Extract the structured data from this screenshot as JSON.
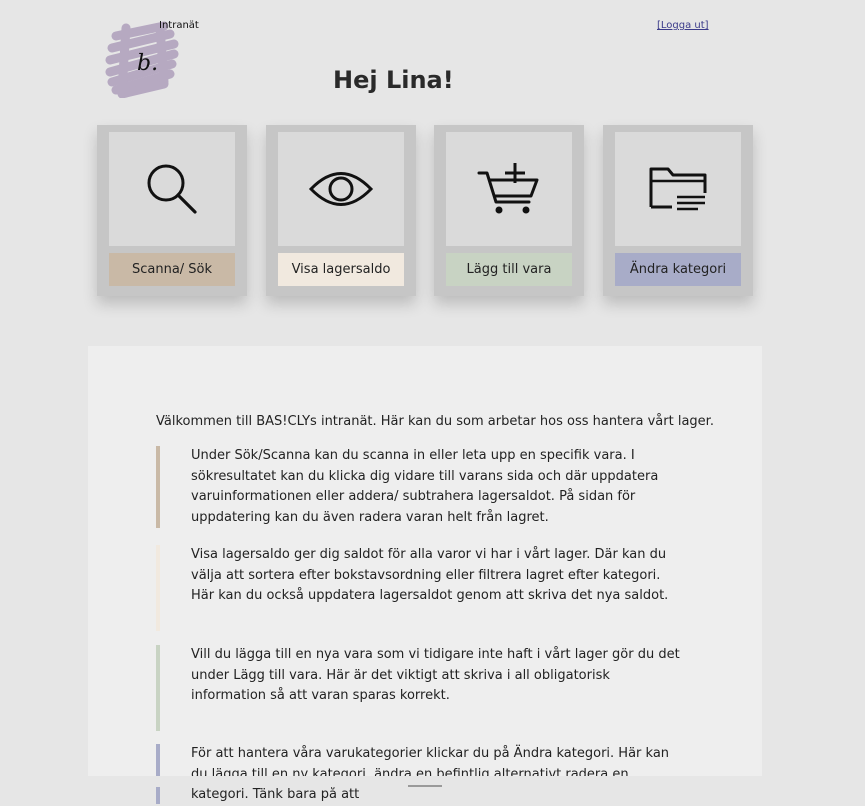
{
  "header": {
    "logo_letter": "b.",
    "logo_label": "Intranät",
    "logout_label": "[Logga ut]",
    "greeting": "Hej Lina!"
  },
  "tiles": [
    {
      "label": "Scanna/ Sök",
      "icon": "search-icon",
      "color": "#c9b9a6"
    },
    {
      "label": "Visa lagersaldo",
      "icon": "eye-icon",
      "color": "#f1e9df"
    },
    {
      "label": "Lägg till vara",
      "icon": "cart-add-icon",
      "color": "#c8d3c3"
    },
    {
      "label": "Ändra kategori",
      "icon": "folder-icon",
      "color": "#a8acc8"
    }
  ],
  "content": {
    "intro": "Välkommen till BAS!CLYs intranät. Här kan du som arbetar hos oss hantera vårt lager.",
    "blocks": [
      {
        "text": "Under Sök/Scanna kan du scanna in eller leta upp en specifik vara. I sökresultatet kan du klicka dig vidare till varans sida och där uppdatera varuinformationen eller addera/ subtrahera lagersaldot. På sidan för uppdatering kan du även radera varan helt från lagret.",
        "color": "#c9b9a6"
      },
      {
        "text": "Visa lagersaldo ger dig saldot för alla varor vi har i vårt lager. Där kan du välja att sortera efter bokstavsordning eller filtrera lagret efter kategori. Här kan du också uppdatera lagersaldot genom att skriva det nya saldot.",
        "color": "#f1e9df"
      },
      {
        "text": "Vill du lägga till en nya vara som vi tidigare inte haft i vårt lager gör du det under Lägg till vara. Här är det viktigt att skriva i all obligatorisk information så att varan sparas korrekt.",
        "color": "#c8d3c3"
      },
      {
        "text": "För att hantera våra varukategorier klickar du på Ändra kategori. Här kan du lägga till en ny kategori, ändra en befintlig alternativt radera en kategori. Tänk bara på att",
        "color": "#a8acc8"
      }
    ]
  },
  "colors": {
    "page_bg": "#e6e6e6",
    "tile_bg": "#c6c6c6",
    "icon_bg": "#dadada",
    "panel_bg": "#eeeeee",
    "logo_scribble": "#b4a6c0"
  }
}
